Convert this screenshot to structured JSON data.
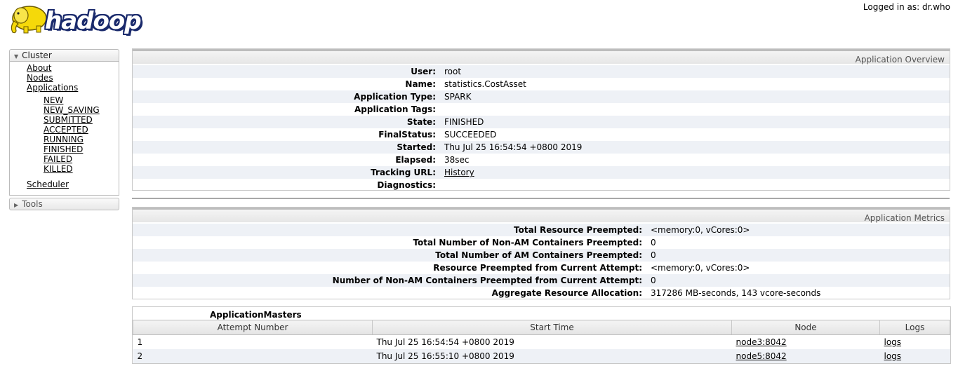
{
  "header": {
    "logo_text": "hadoop",
    "logged_in": "Logged in as: dr.who"
  },
  "nav": {
    "cluster_label": "Cluster",
    "links": [
      {
        "label": "About"
      },
      {
        "label": "Nodes"
      },
      {
        "label": "Applications"
      }
    ],
    "app_states": [
      "NEW",
      "NEW_SAVING",
      "SUBMITTED",
      "ACCEPTED",
      "RUNNING",
      "FINISHED",
      "FAILED",
      "KILLED"
    ],
    "scheduler_label": "Scheduler",
    "tools_label": "Tools"
  },
  "overview": {
    "title": "Application Overview",
    "rows": [
      {
        "key": "User:",
        "value": "root"
      },
      {
        "key": "Name:",
        "value": "statistics.CostAsset"
      },
      {
        "key": "Application Type:",
        "value": "SPARK"
      },
      {
        "key": "Application Tags:",
        "value": ""
      },
      {
        "key": "State:",
        "value": "FINISHED"
      },
      {
        "key": "FinalStatus:",
        "value": "SUCCEEDED"
      },
      {
        "key": "Started:",
        "value": "Thu Jul 25 16:54:54 +0800 2019"
      },
      {
        "key": "Elapsed:",
        "value": "38sec"
      },
      {
        "key": "Tracking URL:",
        "value": "History"
      },
      {
        "key": "Diagnostics:",
        "value": ""
      }
    ]
  },
  "metrics": {
    "title": "Application Metrics",
    "rows": [
      {
        "key": "Total Resource Preempted:",
        "value": "<memory:0, vCores:0>"
      },
      {
        "key": "Total Number of Non-AM Containers Preempted:",
        "value": "0"
      },
      {
        "key": "Total Number of AM Containers Preempted:",
        "value": "0"
      },
      {
        "key": "Resource Preempted from Current Attempt:",
        "value": "<memory:0, vCores:0>"
      },
      {
        "key": "Number of Non-AM Containers Preempted from Current Attempt:",
        "value": "0"
      },
      {
        "key": "Aggregate Resource Allocation:",
        "value": "317286 MB-seconds, 143 vcore-seconds"
      }
    ]
  },
  "masters": {
    "caption": "ApplicationMasters",
    "columns": [
      "Attempt Number",
      "Start Time",
      "Node",
      "Logs"
    ],
    "rows": [
      {
        "attempt": "1",
        "start": "Thu Jul 25 16:54:54 +0800 2019",
        "node": "node3:8042",
        "logs": "logs"
      },
      {
        "attempt": "2",
        "start": "Thu Jul 25 16:55:10 +0800 2019",
        "node": "node5:8042",
        "logs": "logs"
      }
    ]
  },
  "colors": {
    "stripe": "#eef1f6",
    "border": "#c8c8c8",
    "logo_outline": "#1a2a6c",
    "elephant": "#f5d90a"
  }
}
